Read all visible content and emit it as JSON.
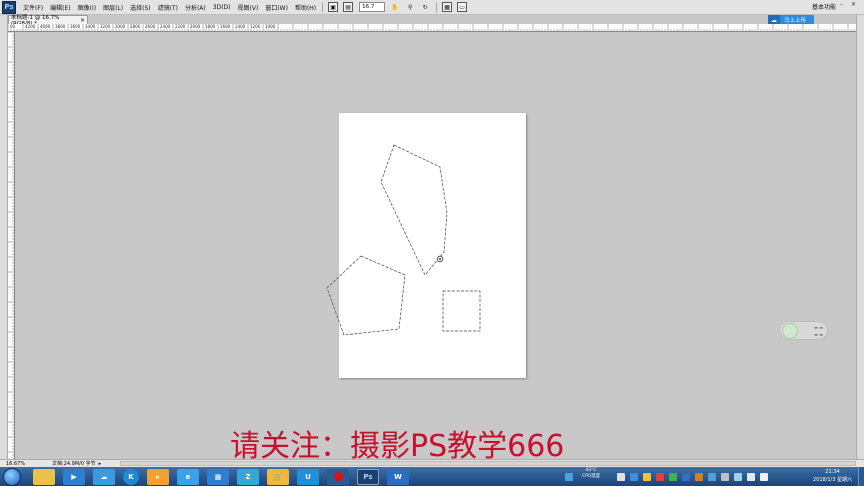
{
  "app": {
    "logo": "Ps",
    "menus": [
      "文件(F)",
      "编辑(E)",
      "图像(I)",
      "图层(L)",
      "选择(S)",
      "滤镜(T)",
      "分析(A)",
      "3D(D)",
      "视图(V)",
      "窗口(W)",
      "帮助(H)"
    ],
    "zoom_value": "16.7",
    "workspace": "基本功能"
  },
  "share_button": {
    "label": "马上上传"
  },
  "document_tab": {
    "title": "未标题-1 @ 16.7%(RGB/8) *",
    "close": "×"
  },
  "ruler": {
    "numbers": [
      "00",
      "4200",
      "4000",
      "3800",
      "3600",
      "3400",
      "3200",
      "3000",
      "2800",
      "2600",
      "2400",
      "2200",
      "2000",
      "1800",
      "1600",
      "1400",
      "1200",
      "1000"
    ]
  },
  "status": {
    "zoom": "16.67%",
    "doc_info": "文档:24.9M/0 字节"
  },
  "watermark": "请关注：摄影PS教学666",
  "taskbar": {
    "cpu_temp": "43°C",
    "cpu_label": "CPU温度",
    "time": "21:34",
    "date": "2018/1/3 星期六"
  },
  "colors": {
    "accent": "#2f8ad8",
    "watermark": "#c8102e",
    "taskbar": "#1c4478"
  }
}
